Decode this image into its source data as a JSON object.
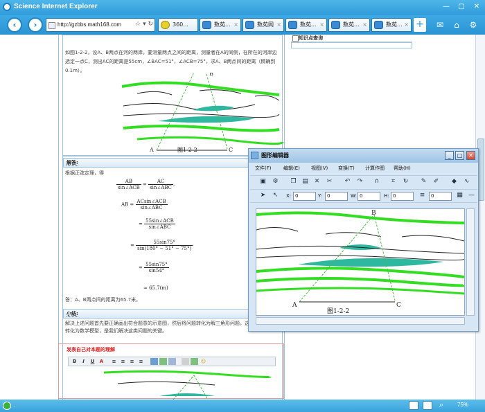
{
  "window": {
    "title": "Science Internet Explorer"
  },
  "toolbar": {
    "address": "http://gzbbs.math168.com",
    "tabs": [
      {
        "label": "360..."
      },
      {
        "label": "数苑..."
      },
      {
        "label": "数苑网"
      },
      {
        "label": "数苑..."
      },
      {
        "label": "数苑..."
      },
      {
        "label": "数苑..."
      }
    ],
    "new_tab": "+"
  },
  "page": {
    "problem_text": "如图1-2-2，设A、B两点在河的两岸，要测量两点之间的距离，测量者在A的同侧，在所在的河岸边选定一点C，测出AC的距离是55cm，∠BAC=51°，∠ACB=75°，求A、B两点间的距离（精确到0.1m）。",
    "figure_caption": "图1-2-2",
    "point_a": "A",
    "point_b": "B",
    "point_c": "C",
    "answer_header": "解答:",
    "answer_intro": "根据正弦定理，得",
    "math": {
      "l1_left_n": "AB",
      "l1_left_d": "sin∠ACB",
      "l1_right_n": "AC",
      "l1_right_d": "sin∠ABC",
      "l2_prefix": "AB =",
      "l2_n": "ACsin∠ACB",
      "l2_d": "sin∠ABC",
      "l3_prefix": "=",
      "l3_n": "55sin∠ACB",
      "l3_d": "sin∠ABC",
      "l4_prefix": "=",
      "l4_n": "55sin75°",
      "l4_d": "sin(180° − 51° − 75°)",
      "l5_prefix": "=",
      "l5_n": "55sin75°",
      "l5_d": "sin54°",
      "l6": "≈ 65.7(m)"
    },
    "answer_conclusion": "答：A、B两点间的距离为65.7米。",
    "summary_header": "小结:",
    "summary_text": "解决上述问题首先要正确画出符合题意的示意图，然后将问题转化为解三角形问题，这是将实际问题转化为数学模型，是我们解决这类问题的关键。",
    "right_panel_title": "知识点查询",
    "post_title": "发表自己对本题的理解",
    "editor_buttons": [
      "B",
      "I",
      "U",
      "A"
    ]
  },
  "dialog": {
    "title": "图形编辑器",
    "menu": [
      "文件(F)",
      "编辑(E)",
      "视图(V)",
      "变换(T)",
      "计算作图",
      "帮助(H)"
    ],
    "fields": {
      "x_label": "X:",
      "x_value": "0",
      "y_label": "Y:",
      "y_value": "0",
      "w_label": "W:",
      "w_value": "0",
      "h_label": "H:",
      "h_value": "0",
      "line_value": "0"
    },
    "figure_caption": "图1-2-2",
    "point_a": "A",
    "point_b": "B",
    "point_c": "C"
  },
  "statusbar": {
    "text": ".",
    "zoom": "75%"
  },
  "colors": {
    "river_green": "#33dd22",
    "water_teal": "#2fb8a0",
    "dashed_line": "#44bb44",
    "chrome_blue": "#3aa3dc"
  }
}
